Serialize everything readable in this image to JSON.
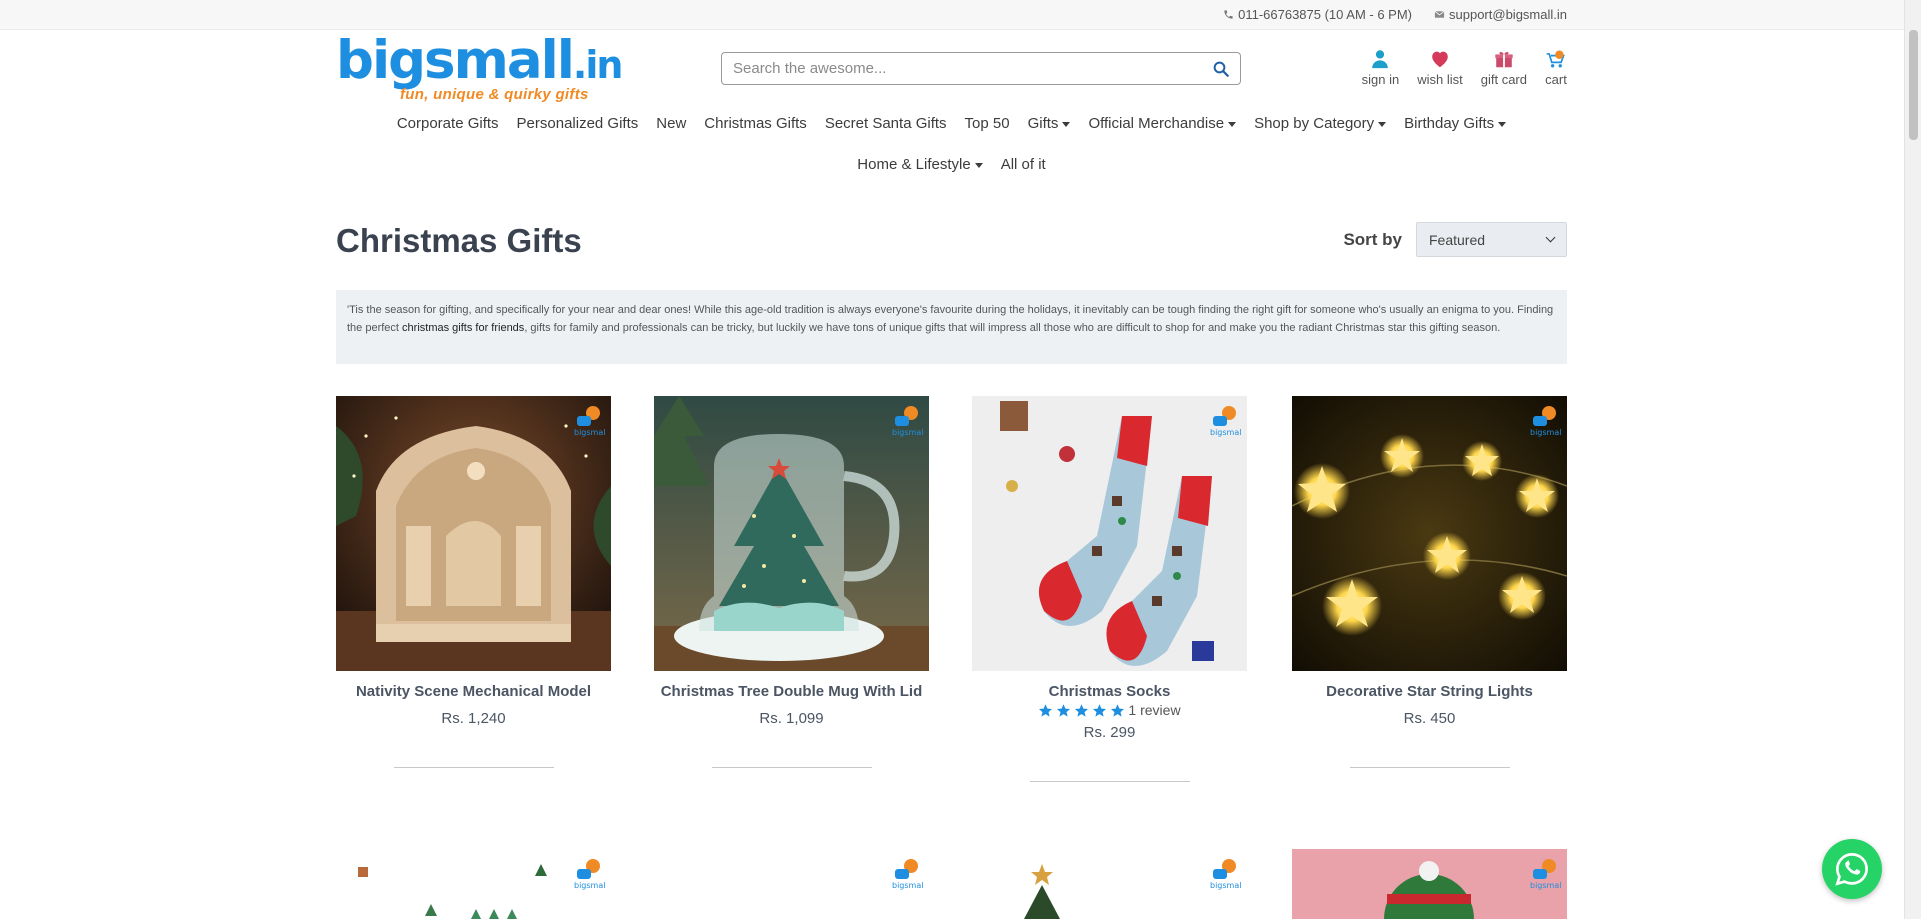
{
  "topbar": {
    "phone": "011-66763875 (10 AM - 6 PM)",
    "email": "support@bigsmall.in"
  },
  "logo": {
    "name": "bigsmall.in",
    "tagline": "fun, unique & quirky gifts"
  },
  "search": {
    "placeholder": "Search the awesome..."
  },
  "header_links": {
    "sign_in": "sign in",
    "wish_list": "wish list",
    "gift_card": "gift card",
    "cart": "cart"
  },
  "nav": {
    "row1": [
      {
        "label": "Corporate Gifts",
        "dropdown": false
      },
      {
        "label": "Personalized Gifts",
        "dropdown": false
      },
      {
        "label": "New",
        "dropdown": false
      },
      {
        "label": "Christmas Gifts",
        "dropdown": false
      },
      {
        "label": "Secret Santa Gifts",
        "dropdown": false
      },
      {
        "label": "Top 50",
        "dropdown": false
      },
      {
        "label": "Gifts",
        "dropdown": true
      },
      {
        "label": "Official Merchandise",
        "dropdown": true
      },
      {
        "label": "Shop by Category",
        "dropdown": true
      },
      {
        "label": "Birthday Gifts",
        "dropdown": true
      }
    ],
    "row2": [
      {
        "label": "Home & Lifestyle",
        "dropdown": true
      },
      {
        "label": "All of it",
        "dropdown": false
      }
    ]
  },
  "page": {
    "title": "Christmas Gifts",
    "sort_label": "Sort by",
    "sort_value": "Featured",
    "intro_part1": "'Tis the season for gifting, and specifically for your near and dear ones! While this age-old tradition is always everyone's favourite during the holidays, it inevitably can be tough finding the right gift for someone who's usually an enigma to you. Finding the perfect ",
    "intro_link": "christmas gifts for friends",
    "intro_part2": ", gifts for family and professionals can be tricky, but luckily we have tons of unique gifts that will impress all those who are difficult to shop for and make you the radiant Christmas star this gifting season."
  },
  "products": [
    {
      "name": "Nativity Scene Mechanical Model",
      "price": "Rs. 1,240",
      "reviews": "",
      "rating": 0
    },
    {
      "name": "Christmas Tree Double Mug With Lid",
      "price": "Rs. 1,099",
      "reviews": "",
      "rating": 0
    },
    {
      "name": "Christmas Socks",
      "price": "Rs. 299",
      "reviews": "1 review",
      "rating": 5
    },
    {
      "name": "Decorative Star String Lights",
      "price": "Rs. 450",
      "reviews": "",
      "rating": 0
    }
  ],
  "colors": {
    "brand_blue": "#1e8fe0",
    "brand_orange": "#f08a24",
    "whatsapp_green": "#25d366"
  }
}
